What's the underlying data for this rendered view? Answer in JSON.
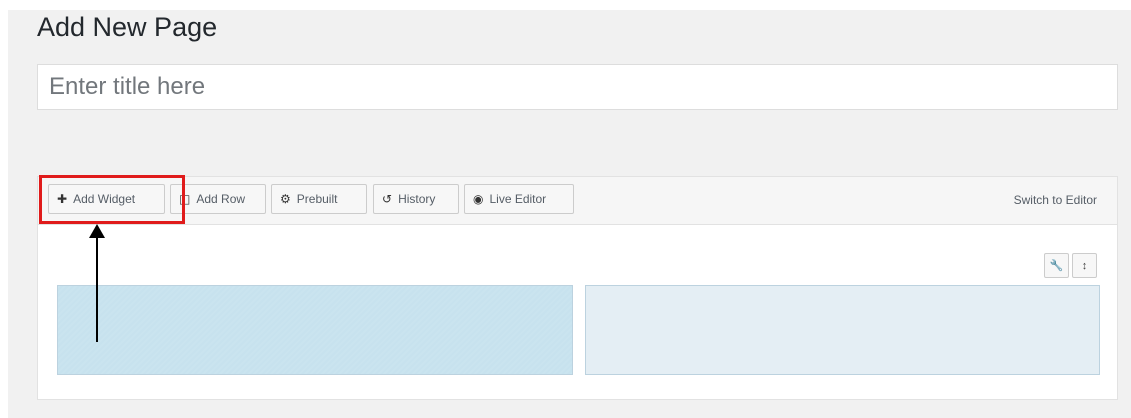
{
  "page": {
    "title": "Add New Page"
  },
  "title_field": {
    "placeholder": "Enter title here",
    "value": ""
  },
  "toolbar": {
    "buttons": [
      {
        "icon": "plus-icon",
        "label": "Add Widget"
      },
      {
        "icon": "row-icon",
        "label": "Add Row"
      },
      {
        "icon": "prebuilt-icon",
        "label": "Prebuilt"
      },
      {
        "icon": "history-icon",
        "label": "History"
      },
      {
        "icon": "eye-icon",
        "label": "Live Editor"
      }
    ],
    "switch_label": "Switch to Editor"
  },
  "row": {
    "tools": [
      {
        "icon": "wrench-icon"
      },
      {
        "icon": "move-vertical-icon"
      }
    ],
    "cells": [
      {
        "state": "selected"
      },
      {
        "state": "default"
      }
    ]
  },
  "colors": {
    "highlight": "#e01b1b",
    "cell_selected": "#c7e2ee",
    "cell_default": "#e4eef4"
  }
}
